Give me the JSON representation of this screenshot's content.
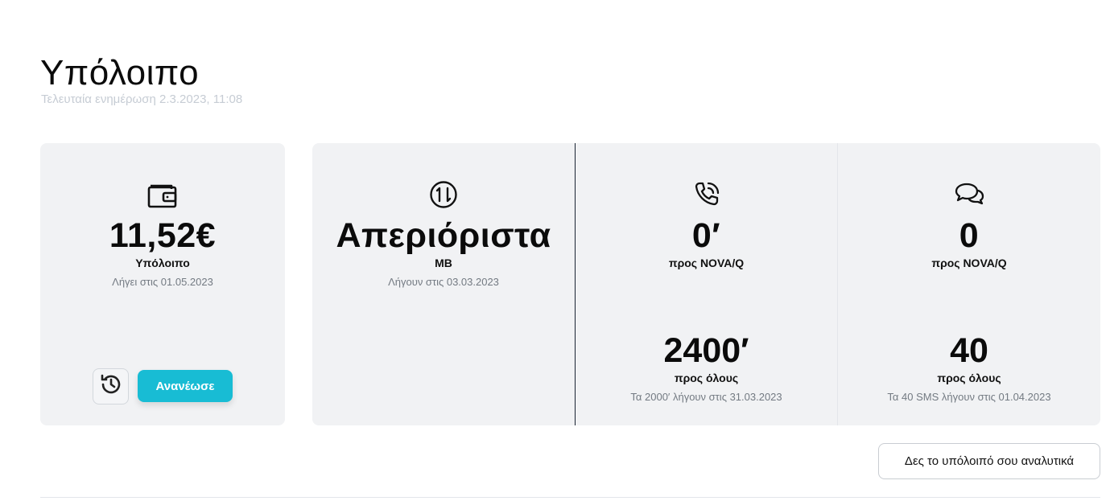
{
  "header": {
    "title": "Υπόλοιπο",
    "last_update": "Τελευταία ενημέρωση 2.3.2023, 11:08"
  },
  "wallet": {
    "icon": "wallet-icon",
    "amount": "11,52€",
    "label": "Υπόλοιπο",
    "expiry": "Λήγει στις 01.05.2023",
    "history_icon": "history-icon",
    "renew_label": "Ανανέωσε"
  },
  "data": {
    "icon": "data-transfer-icon",
    "value": "Απεριόριστα",
    "unit": "MB",
    "expiry": "Λήγουν στις 03.03.2023"
  },
  "voice": {
    "icon": "phone-icon",
    "onnet_value": "0′",
    "onnet_label": "προς NOVA/Q",
    "all_value": "2400′",
    "all_label": "προς όλους",
    "all_expiry": "Τα 2000′ λήγουν στις 31.03.2023"
  },
  "sms": {
    "icon": "chat-icon",
    "onnet_value": "0",
    "onnet_label": "προς NOVA/Q",
    "all_value": "40",
    "all_label": "προς όλους",
    "all_expiry": "Τα 40 SMS λήγουν στις 01.04.2023"
  },
  "footer": {
    "detail_button": "Δες το υπόλοιπό σου αναλυτικά"
  },
  "colors": {
    "accent": "#18bcd4",
    "card_bg": "#f1f2f4"
  }
}
